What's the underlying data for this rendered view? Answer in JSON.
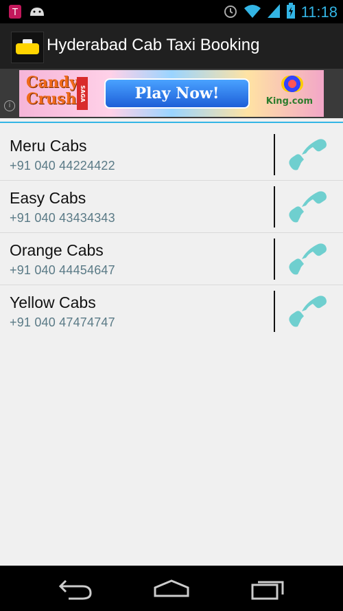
{
  "status_bar": {
    "time": "11:18"
  },
  "action_bar": {
    "title": "Hyderabad Cab Taxi Booking"
  },
  "ad": {
    "brand_line1": "Candy",
    "brand_line2": "Crush",
    "saga": "SAGA",
    "cta": "Play Now!",
    "advertiser": "King.com",
    "info": "i"
  },
  "contacts": [
    {
      "name": "Meru Cabs",
      "phone": "+91 040 44224422"
    },
    {
      "name": "Easy Cabs",
      "phone": "+91 040 43434343"
    },
    {
      "name": "Orange Cabs",
      "phone": "+91 040 44454647"
    },
    {
      "name": "Yellow Cabs",
      "phone": "+91 040 47474747"
    }
  ],
  "colors": {
    "accent": "#33b5e5",
    "call_icon": "#6fcfcf",
    "phone_text": "#5a7a86"
  },
  "icons": [
    "tmobile-icon",
    "android-icon",
    "alarm-icon",
    "wifi-icon",
    "signal-icon",
    "battery-icon",
    "phone-icon",
    "back-icon",
    "home-icon",
    "recent-apps-icon"
  ]
}
